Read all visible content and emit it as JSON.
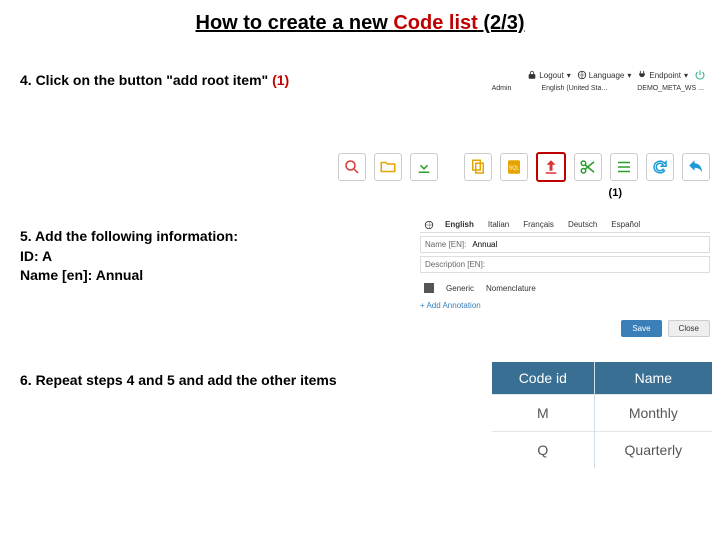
{
  "title_prefix": "How to create a new ",
  "title_red": "Code list",
  "title_suffix": " (2/3)",
  "step4": {
    "text": "4.  Click on the button \"add root item\" ",
    "marker": "(1)"
  },
  "topbar": {
    "logout": "Logout",
    "language": "Language",
    "endpoint": "Endpoint",
    "logout_sub": "Admin",
    "language_sub": "English (United Sta...",
    "endpoint_sub": "DEMO_META_WS ..."
  },
  "callout": "(1)",
  "step5": {
    "line1": "5.  Add the following information:",
    "line2": "ID: A",
    "line3": "Name [en]: Annual"
  },
  "form": {
    "tabs": [
      "English",
      "Italian",
      "Français",
      "Deutsch",
      "Español"
    ],
    "active_tab": "English",
    "field_prefix": "Name [EN]:",
    "field_value": "Annual",
    "desc_prefix": "Description [EN]:",
    "section1": "Generic",
    "section2": "Nomenclature",
    "add_annotation": "+ Add Annotation",
    "save": "Save",
    "close": "Close"
  },
  "step6": "6.  Repeat steps 4 and 5 and add the other items",
  "table": {
    "headers": [
      "Code id",
      "Name"
    ],
    "rows": [
      [
        "M",
        "Monthly"
      ],
      [
        "Q",
        "Quarterly"
      ]
    ]
  }
}
